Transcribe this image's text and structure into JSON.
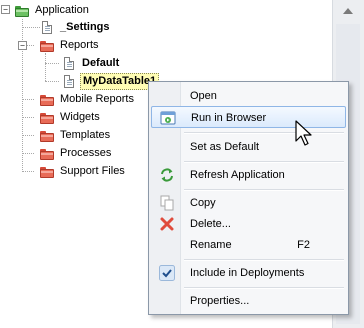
{
  "tree": {
    "items": [
      {
        "label": "Application"
      },
      {
        "label": "_Settings"
      },
      {
        "label": "Reports"
      },
      {
        "label": "Default"
      },
      {
        "label": "MyDataTable1"
      },
      {
        "label": "Mobile Reports"
      },
      {
        "label": "Widgets"
      },
      {
        "label": "Templates"
      },
      {
        "label": "Processes"
      },
      {
        "label": "Support Files"
      }
    ]
  },
  "context_menu": {
    "items": [
      {
        "label": "Open"
      },
      {
        "label": "Run in Browser"
      },
      {
        "label": "Set as Default"
      },
      {
        "label": "Refresh Application"
      },
      {
        "label": "Copy"
      },
      {
        "label": "Delete..."
      },
      {
        "label": "Rename",
        "shortcut": "F2"
      },
      {
        "label": "Include in Deployments"
      },
      {
        "label": "Properties..."
      }
    ]
  },
  "colors": {
    "folder_red": "#e86b57",
    "folder_green": "#6cc163",
    "menu_highlight": "#dbeafc",
    "selected_item_bg": "#fffdb4"
  }
}
